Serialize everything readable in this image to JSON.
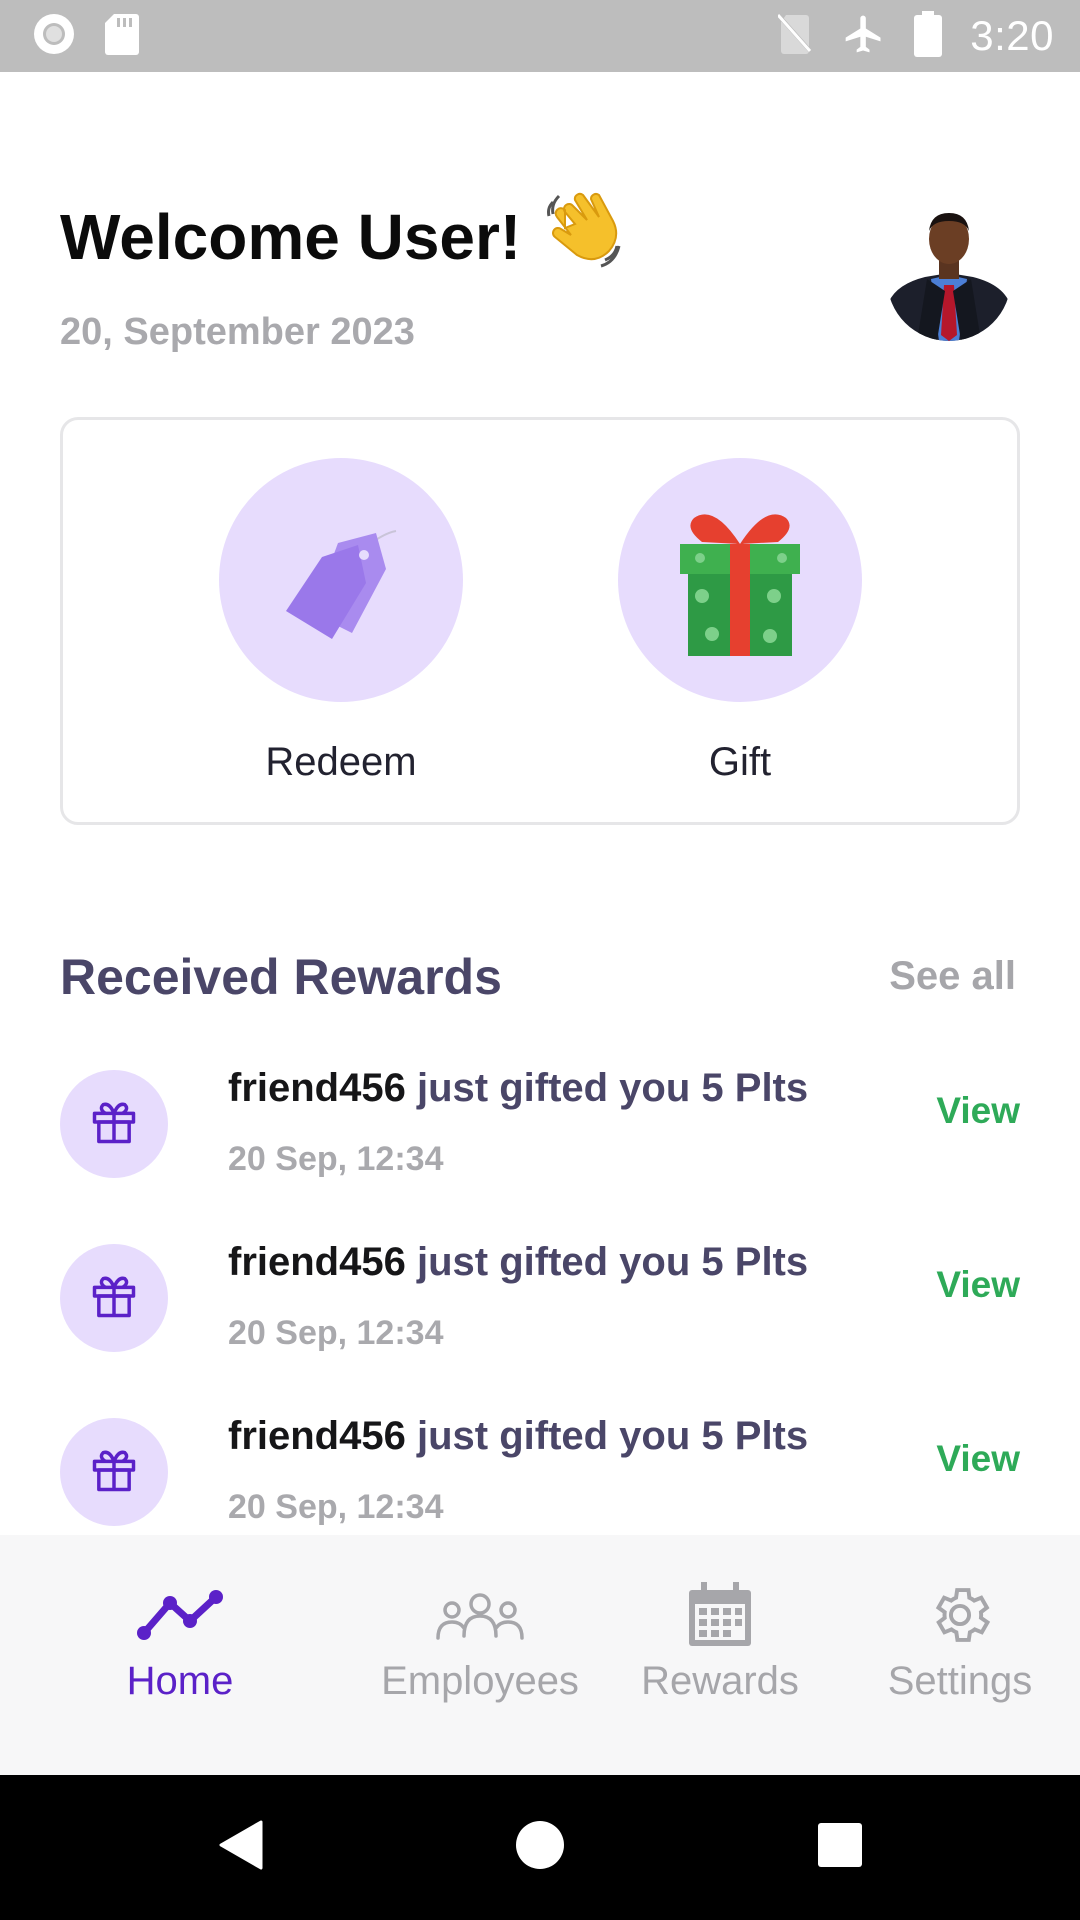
{
  "status_bar": {
    "time": "3:20",
    "left_icons": [
      "record-icon",
      "sd-card-icon"
    ],
    "right_icons": [
      "no-sim-icon",
      "airplane-icon",
      "battery-icon"
    ]
  },
  "header": {
    "welcome_text": "Welcome User!",
    "welcome_emoji": "👋",
    "date": "20, September 2023"
  },
  "actions": [
    {
      "label": "Redeem",
      "icon": "price-tag-icon"
    },
    {
      "label": "Gift",
      "icon": "gift-box-icon"
    }
  ],
  "received_rewards": {
    "title": "Received Rewards",
    "see_all_label": "See all",
    "items": [
      {
        "sender": "friend456",
        "message": " just gifted you 5 Plts",
        "time": "20 Sep, 12:34",
        "action": "View"
      },
      {
        "sender": "friend456",
        "message": " just gifted you 5 Plts",
        "time": "20 Sep, 12:34",
        "action": "View"
      },
      {
        "sender": "friend456",
        "message": " just gifted you 5 Plts",
        "time": "20 Sep, 12:34",
        "action": "View"
      }
    ]
  },
  "bottom_nav": {
    "items": [
      {
        "label": "Home",
        "icon": "trend-line-icon",
        "active": true
      },
      {
        "label": "Employees",
        "icon": "people-icon",
        "active": false
      },
      {
        "label": "Rewards",
        "icon": "calendar-icon",
        "active": false
      },
      {
        "label": "Settings",
        "icon": "gear-icon",
        "active": false
      }
    ]
  },
  "colors": {
    "accent": "#5b21c8",
    "icon_bg": "#e7dcfd",
    "view_green": "#2eaa58",
    "heading": "#4a4668",
    "muted": "#a9a9ad"
  }
}
